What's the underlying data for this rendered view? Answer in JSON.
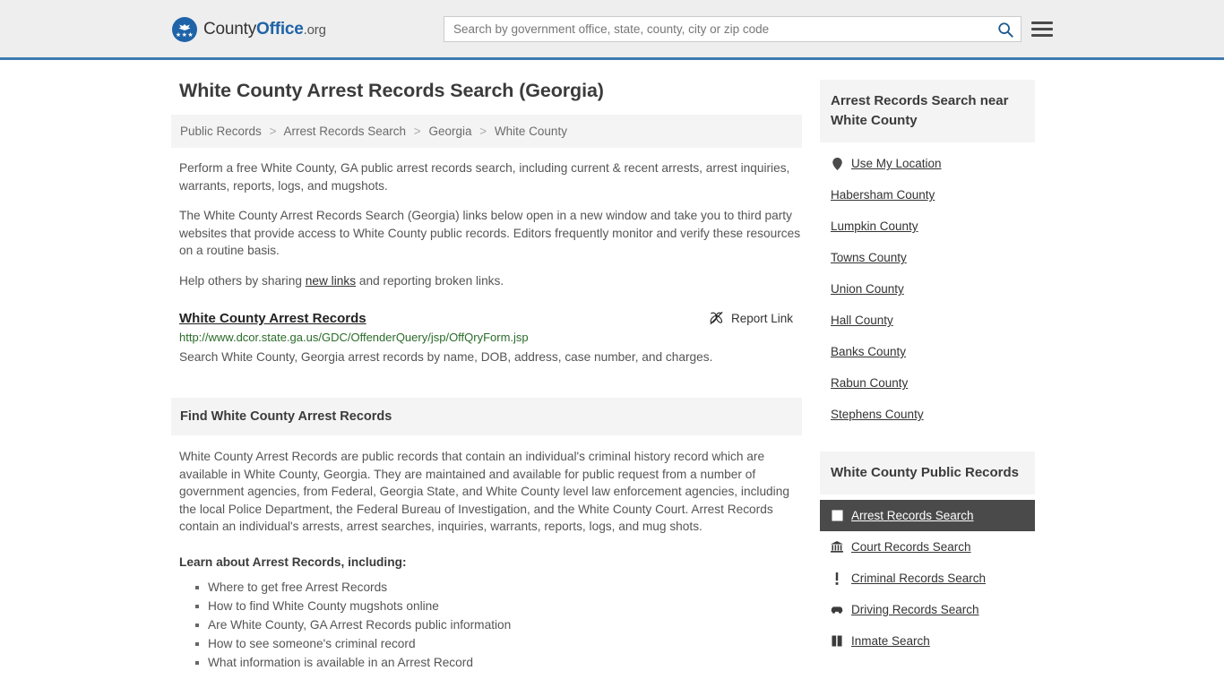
{
  "header": {
    "logo": {
      "part1": "County",
      "part2": "Office",
      "tld": ".org",
      "icon": "eagle-seal-icon",
      "stars": "★★★"
    },
    "search": {
      "placeholder": "Search by government office, state, county, city or zip code",
      "value": "",
      "button_icon": "search-icon"
    },
    "menu_icon": "hamburger-menu-icon",
    "accent_color": "#3d7ab0"
  },
  "main": {
    "title": "White County Arrest Records Search (Georgia)",
    "breadcrumb": [
      {
        "label": "Public Records",
        "current": false
      },
      {
        "label": "Arrest Records Search",
        "current": false
      },
      {
        "label": "Georgia",
        "current": false
      },
      {
        "label": "White County",
        "current": true
      }
    ],
    "breadcrumb_separator": ">",
    "intro_p1": "Perform a free White County, GA public arrest records search, including current & recent arrests, arrest inquiries, warrants, reports, logs, and mugshots.",
    "intro_p2": "The White County Arrest Records Search (Georgia) links below open in a new window and take you to third party websites that provide access to White County public records. Editors frequently monitor and verify these resources on a routine basis.",
    "share_prefix": "Help others by sharing ",
    "share_link": "new links",
    "share_suffix": " and reporting broken links.",
    "result": {
      "title": "White County Arrest Records",
      "report_label": "Report Link",
      "report_icon": "broken-link-icon",
      "url": "http://www.dcor.state.ga.us/GDC/OffenderQuery/jsp/OffQryForm.jsp",
      "description": "Search White County, Georgia arrest records by name, DOB, address, case number, and charges."
    },
    "find_section": {
      "heading": "Find White County Arrest Records",
      "paragraph": "White County Arrest Records are public records that contain an individual's criminal history record which are available in White County, Georgia. They are maintained and available for public request from a number of government agencies, from Federal, Georgia State, and White County level law enforcement agencies, including the local Police Department, the Federal Bureau of Investigation, and the White County Court. Arrest Records contain an individual's arrests, arrest searches, inquiries, warrants, reports, logs, and mug shots.",
      "learn_heading": "Learn about Arrest Records, including:",
      "bullets": [
        "Where to get free Arrest Records",
        "How to find White County mugshots online",
        "Are White County, GA Arrest Records public information",
        "How to see someone's criminal record",
        "What information is available in an Arrest Record"
      ]
    }
  },
  "sidebar": {
    "near_panel": {
      "heading": "Arrest Records Search near White County",
      "items": [
        {
          "label": "Use My Location",
          "icon": "map-pin-icon",
          "active": false
        },
        {
          "label": "Habersham County",
          "icon": "",
          "active": false
        },
        {
          "label": "Lumpkin County",
          "icon": "",
          "active": false
        },
        {
          "label": "Towns County",
          "icon": "",
          "active": false
        },
        {
          "label": "Union County",
          "icon": "",
          "active": false
        },
        {
          "label": "Hall County",
          "icon": "",
          "active": false
        },
        {
          "label": "Banks County",
          "icon": "",
          "active": false
        },
        {
          "label": "Rabun County",
          "icon": "",
          "active": false
        },
        {
          "label": "Stephens County",
          "icon": "",
          "active": false
        }
      ]
    },
    "records_panel": {
      "heading": "White County Public Records",
      "items": [
        {
          "label": "Arrest Records Search",
          "icon": "fingerprint-card-icon",
          "active": true
        },
        {
          "label": "Court Records Search",
          "icon": "courthouse-icon",
          "active": false
        },
        {
          "label": "Criminal Records Search",
          "icon": "exclamation-icon",
          "active": false
        },
        {
          "label": "Driving Records Search",
          "icon": "car-icon",
          "active": false
        },
        {
          "label": "Inmate Search",
          "icon": "inmate-icon",
          "active": false
        }
      ]
    },
    "active_bg_color": "#4a4a4a"
  }
}
